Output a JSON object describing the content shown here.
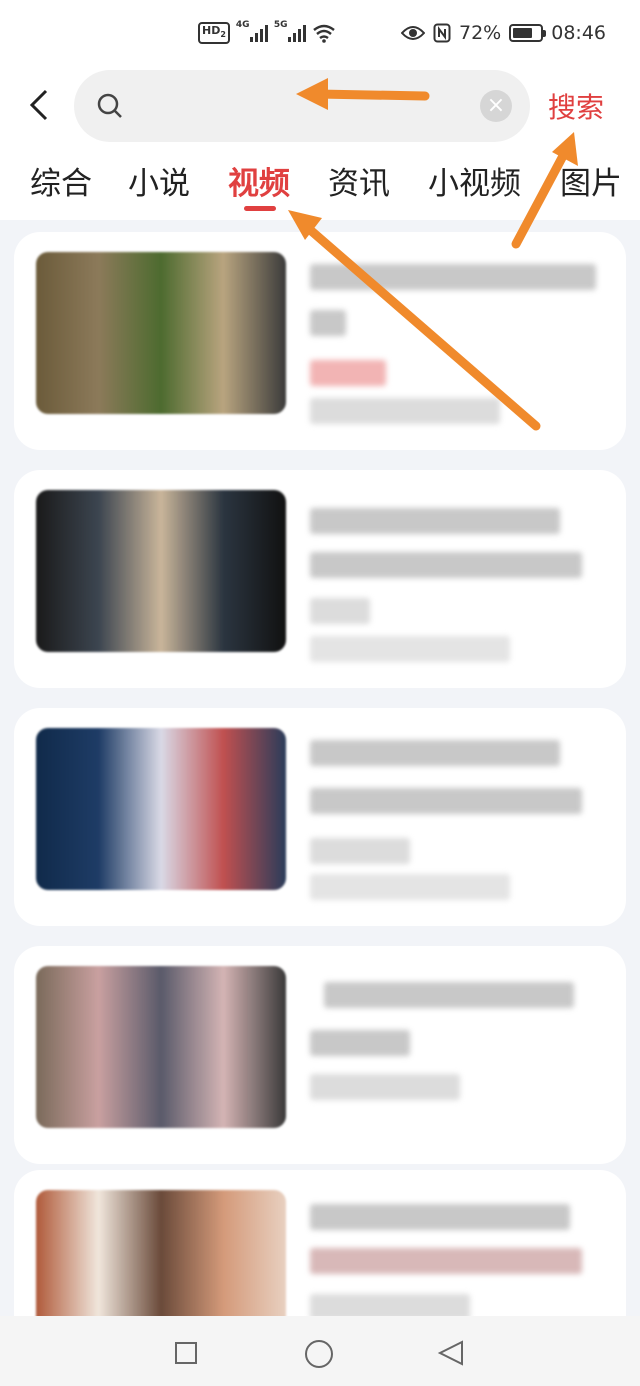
{
  "status_bar": {
    "hd_label": "HD",
    "hd_sub": "2",
    "sim1_label": "4G",
    "sim2_label": "5G",
    "battery_percent": "72%",
    "battery_level": 0.72,
    "time": "08:46"
  },
  "header": {
    "search_query": "",
    "search_button_label": "搜索",
    "tabs": [
      {
        "label": "综合",
        "active": false
      },
      {
        "label": "小说",
        "active": false
      },
      {
        "label": "视频",
        "active": true
      },
      {
        "label": "资讯",
        "active": false
      },
      {
        "label": "小视频",
        "active": false
      },
      {
        "label": "图片",
        "active": false
      }
    ]
  },
  "results": [
    {
      "thumb_colors": [
        "#6b5b3a",
        "#8c7a5a",
        "#4d6b2f",
        "#b9a47f",
        "#3b3b3b"
      ]
    },
    {
      "thumb_colors": [
        "#1a1a1a",
        "#3c4550",
        "#c9b59a",
        "#2b3540",
        "#111111"
      ]
    },
    {
      "thumb_colors": [
        "#102a4a",
        "#1e3c66",
        "#d9d9e6",
        "#c05050",
        "#2a3c5a"
      ]
    },
    {
      "thumb_colors": [
        "#7a6a5a",
        "#c9a0a0",
        "#5a5a6a",
        "#d4b4b4",
        "#3a3a3a"
      ]
    },
    {
      "thumb_colors": [
        "#b05a3a",
        "#f0e6dc",
        "#6a4a3a",
        "#d49a7a",
        "#e8d0c0"
      ]
    }
  ],
  "colors": {
    "accent": "#e04040",
    "annotation_arrow": "#f08a2c",
    "card_bg": "#ffffff",
    "page_bg": "#f2f4f8"
  },
  "icons": {
    "back": "chevron-left-icon",
    "search": "magnifier-icon",
    "clear": "close-circle-icon",
    "eye": "eye-icon",
    "nfc": "nfc-icon",
    "wifi": "wifi-icon",
    "nav_recent": "square-icon",
    "nav_home": "circle-icon",
    "nav_back": "triangle-back-icon"
  }
}
